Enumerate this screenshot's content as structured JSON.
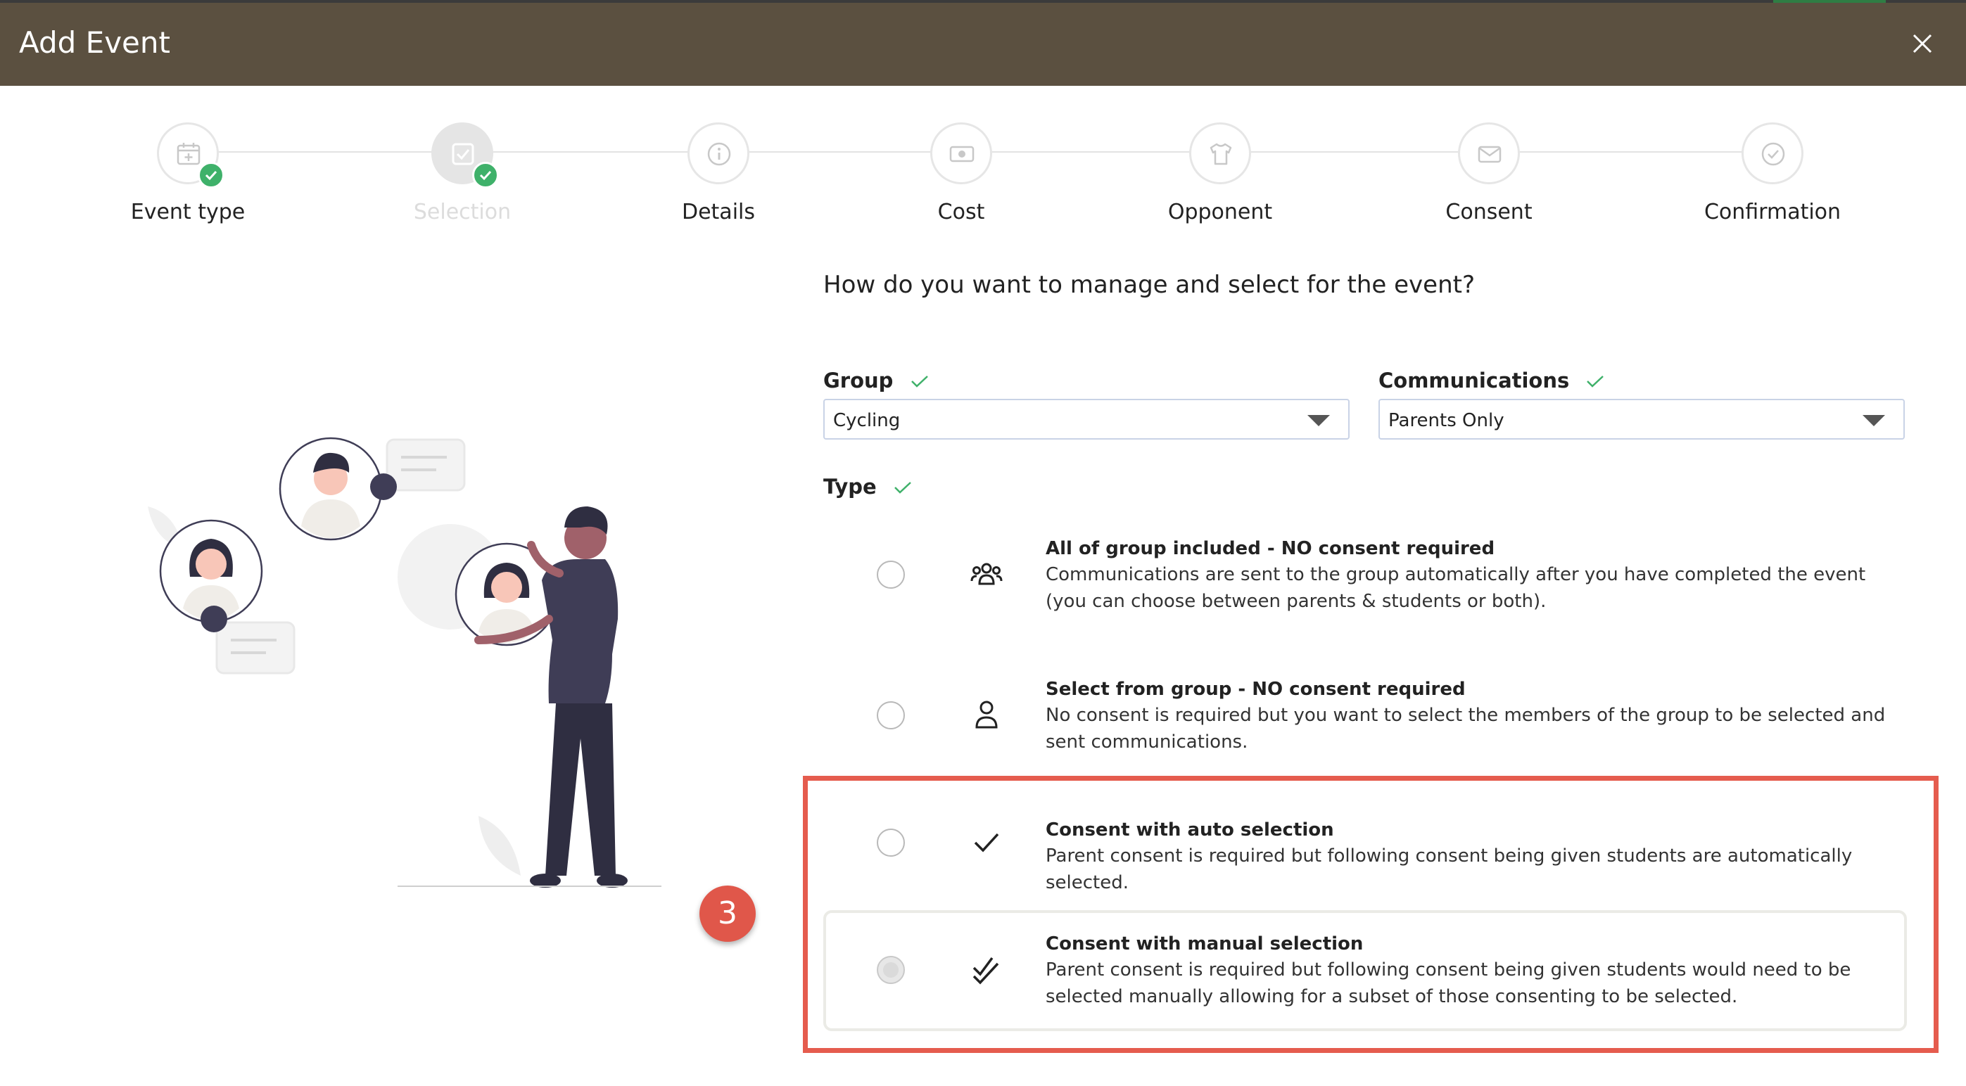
{
  "window": {
    "title": "Add Event"
  },
  "steps": [
    {
      "label": "Event type",
      "icon": "calendar-plus-icon",
      "completed": true,
      "active": false
    },
    {
      "label": "Selection",
      "icon": "checkbox-icon",
      "completed": true,
      "active": true
    },
    {
      "label": "Details",
      "icon": "info-icon",
      "completed": false,
      "active": false
    },
    {
      "label": "Cost",
      "icon": "money-icon",
      "completed": false,
      "active": false
    },
    {
      "label": "Opponent",
      "icon": "shirt-icon",
      "completed": false,
      "active": false
    },
    {
      "label": "Consent",
      "icon": "envelope-icon",
      "completed": false,
      "active": false
    },
    {
      "label": "Confirmation",
      "icon": "check-circle-icon",
      "completed": false,
      "active": false
    }
  ],
  "form": {
    "question": "How do you want to manage and select for the event?",
    "group": {
      "label": "Group",
      "value": "Cycling"
    },
    "communications": {
      "label": "Communications",
      "value": "Parents Only"
    },
    "type": {
      "label": "Type"
    },
    "options": [
      {
        "title": "All of group included - NO consent required",
        "desc": "Communications are sent to the group automatically after you have completed the event (you can choose between parents & students or both).",
        "icon": "group-icon",
        "state": "unselected"
      },
      {
        "title": "Select from group - NO consent required",
        "desc": "No consent is required but you want to select the members of the group to be selected and sent communications.",
        "icon": "person-icon",
        "state": "unselected"
      },
      {
        "title": "Consent with auto selection",
        "desc": "Parent consent is required but following consent being given students are automatically selected.",
        "icon": "check-icon",
        "state": "unselected"
      },
      {
        "title": "Consent with manual selection",
        "desc": "Parent consent is required but following consent being given students would need to be selected manually allowing for a subset of those consenting to be selected.",
        "icon": "double-check-icon",
        "state": "disabled"
      }
    ]
  },
  "annotation": {
    "badge": "3"
  },
  "colors": {
    "titlebar": "#5b5040",
    "success": "#3fb16a",
    "highlight": "#e55c4e",
    "select_border": "#c9d3e6"
  }
}
